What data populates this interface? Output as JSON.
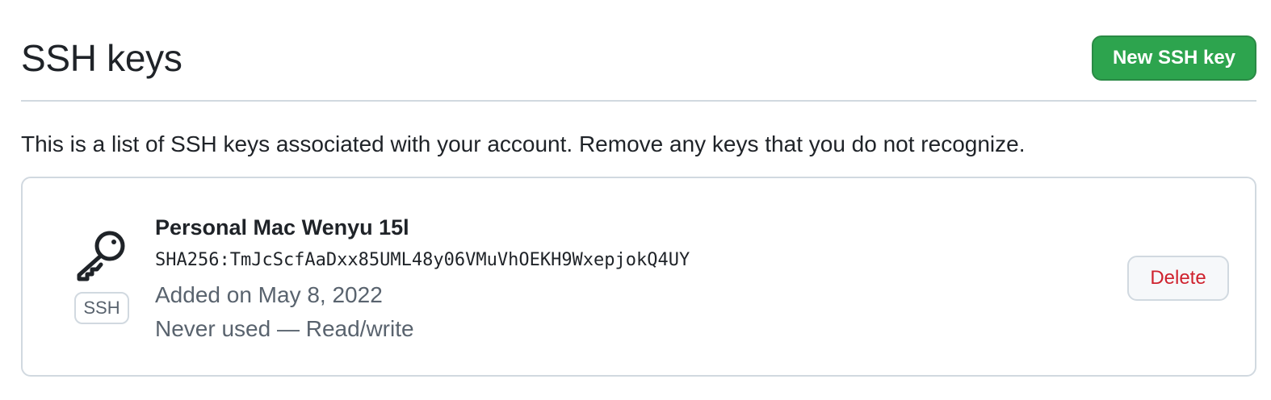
{
  "header": {
    "title": "SSH keys",
    "new_key_label": "New SSH key"
  },
  "intro": "This is a list of SSH keys associated with your account. Remove any keys that you do not recognize.",
  "keys": [
    {
      "icon": "key-icon",
      "type_label": "SSH",
      "title": "Personal Mac Wenyu 15l",
      "fingerprint": "SHA256:TmJcScfAaDxx85UML48y06VMuVhOEKH9WxepjokQ4UY",
      "added_on": "Added on May 8, 2022",
      "usage": "Never used — Read/write",
      "delete_label": "Delete"
    }
  ],
  "colors": {
    "primary_button": "#2da44e",
    "danger_text": "#cf222e",
    "muted_text": "#59636e",
    "border": "#d1d9e0"
  }
}
